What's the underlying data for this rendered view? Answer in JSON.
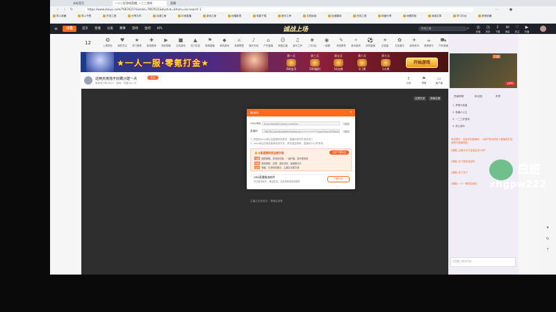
{
  "browser": {
    "tabs": [
      "一二三好游戏直播_一三三游戏",
      "未标签页",
      "直播"
    ],
    "address": "https://www.douyu.com/7667621?roomId=7667621&dyshid=&from=ssr-search-1",
    "bookmarks": [
      "导入收藏",
      "导入书签",
      "开发工具",
      "分享文件",
      "动漫之家",
      "抖音直播",
      "游戏之家",
      "优酷影视",
      "电影下载",
      "音乐之声",
      "文档阅读",
      "百度翻译",
      "在线工具",
      "网盘分享",
      "地图导航",
      "阅读文章",
      "学习平台",
      "其他收藏"
    ]
  },
  "site": {
    "logo": "斗鱼",
    "nav": [
      "首页",
      "直播",
      "分类",
      "赛事",
      "游戏",
      "鱼吧",
      "KPL"
    ],
    "search_placeholder": "搜索主播",
    "header_icons": [
      {
        "label": "充值",
        "icon": "coin-icon"
      },
      {
        "label": "历史",
        "icon": "history-icon"
      },
      {
        "label": "下载",
        "icon": "download-icon"
      },
      {
        "label": "消息",
        "icon": "message-icon"
      },
      {
        "label": "关注",
        "icon": "heart-icon"
      },
      {
        "label": "开播",
        "icon": "camera-icon"
      }
    ]
  },
  "categories": [
    "上周排名",
    "我的关注",
    "热门推荐",
    "新游推荐",
    "精彩视频",
    "主机游戏",
    "热门手游",
    "赛事直播",
    "单机游戏",
    "英雄联盟",
    "娱乐天地",
    "户外直播",
    "颜值主播",
    "音乐之声",
    "二次元区",
    "一起看",
    "科技教育",
    "鱼乐星球",
    "体育直播",
    "正能量",
    "文化娱乐",
    "游戏资讯",
    "美食旅行",
    "汽车频道"
  ],
  "rank": "12",
  "banner": {
    "title": "★一人一服·零氪打金★",
    "days": [
      {
        "day": "第一天",
        "reward": "2W金币"
      },
      {
        "day": "第三天",
        "reward": "500福利"
      },
      {
        "day": "第五天",
        "reward": "10点券"
      },
      {
        "day": "第六天",
        "reward": "1门将"
      },
      {
        "day": "第七天",
        "reward": "1大将"
      }
    ],
    "cta": "开始游戏"
  },
  "streamer": {
    "room_title": "这两天雨落不好瞒沙建一点",
    "meta": "房间号7667621 · 游戏 · 热度16.1万",
    "follow": "关注",
    "actions": [
      "分享",
      "举报",
      "客户端"
    ]
  },
  "player": {
    "buttons": [
      "全屏关闭",
      "弹幕设置"
    ],
    "hint": "主播正在休息中，请稍后观看"
  },
  "modal": {
    "title": "推流码",
    "rtmp_label": "rtmp地址",
    "rtmp_value": "rtmp://sendtc3.douyu.com/live",
    "key_label": "直播码",
    "key_value": "7667621rAmGtcJq0Mz?wsSecret=••••••••••••&wsTime=6763a&wsSeek=off&wm=0&tw=0",
    "copy": "复制",
    "notes": [
      "1. 请复制rtmp地址及直播码到推流，直播码请勿外泄给他人",
      "2. rtmp地址在使用期间保持不变，请勿重复获取，直播码24小时有效"
    ],
    "promo_title": "斗鱼直播伴侣全新升级",
    "promo_btn": "立即下载伴侣",
    "promo_lines": [
      {
        "tag": "功能",
        "text": "图层管理、多场景切换、一键开播，操作更简单"
      },
      {
        "tag": "特色",
        "text": "新增美颜、滤镜、虚拟背景，画面更出众"
      },
      {
        "tag": "互动",
        "text": "弹幕、礼物特效展示，主播互动更方便"
      }
    ],
    "tool_name": "OBS直播推流软件",
    "tool_desc": "专业推流软件，兼容性强，支持多种场景和插件",
    "tool_btn": "下载OBS"
  },
  "sidebar": {
    "ad_label": "广告",
    "ad_cta": "立即玩",
    "tabs": [
      "贡献周榜",
      "粉丝团",
      "贵宾"
    ],
    "rows": [
      "1. 梦想与希望",
      "2. 鱼塘小公主",
      "3. 一二三好游戏",
      "4. 热心观众"
    ],
    "chat": [
      "系统提示：欢迎来到直播间，斗鱼严禁未成年人直播或打赏，请遵守直播规范。",
      "[弹幕] 主播今天打金收益怎么样？",
      "[弹幕] 这个服还能进吗",
      "[弹幕] 来了来了",
      "[弹幕] 一人一服零氪爽玩"
    ],
    "chat_placeholder": "这里输入聊天内容"
  },
  "watermark": {
    "name": "白班",
    "id": "xhgpw222"
  }
}
